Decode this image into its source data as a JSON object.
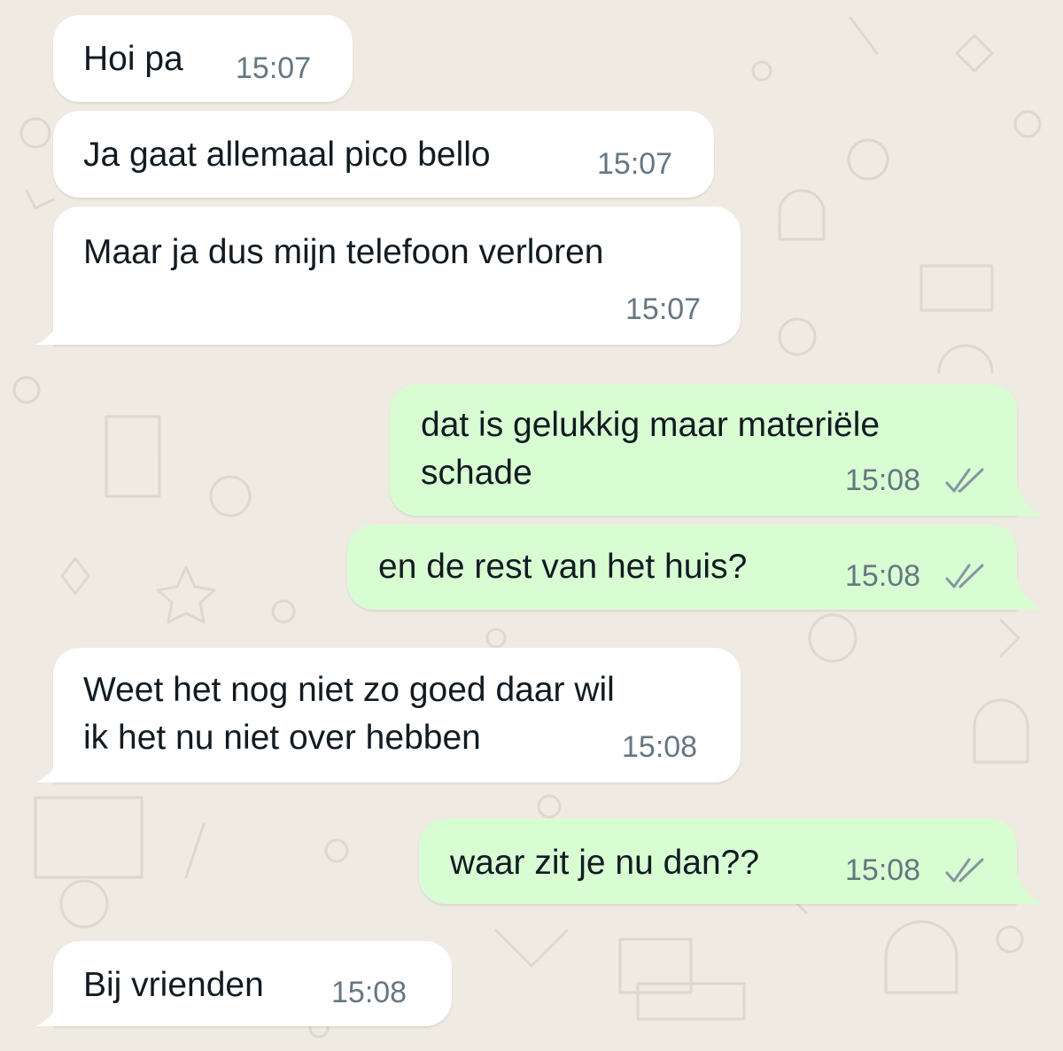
{
  "colors": {
    "wallpaper": "#efeae2",
    "incoming_bubble": "#ffffff",
    "outgoing_bubble": "#d9fdd3",
    "timestamp": "#667781",
    "text": "#111b21"
  },
  "messages": [
    {
      "direction": "incoming",
      "text": "Hoi pa",
      "time": "15:07"
    },
    {
      "direction": "incoming",
      "text": "Ja gaat allemaal pico bello",
      "time": "15:07"
    },
    {
      "direction": "incoming",
      "text": "Maar ja dus mijn telefoon verloren",
      "time": "15:07"
    },
    {
      "direction": "outgoing",
      "line1": "dat is gelukkig maar materiële",
      "line2": "schade",
      "time": "15:08",
      "status_icon": "double-check-icon"
    },
    {
      "direction": "outgoing",
      "text": "en de rest van het huis?",
      "time": "15:08",
      "status_icon": "double-check-icon"
    },
    {
      "direction": "incoming",
      "line1": "Weet het nog niet zo goed daar wil",
      "line2": "ik het nu niet over hebben",
      "time": "15:08"
    },
    {
      "direction": "outgoing",
      "text": "waar zit je nu dan??",
      "time": "15:08",
      "status_icon": "double-check-icon"
    },
    {
      "direction": "incoming",
      "text": "Bij vrienden",
      "time": "15:08"
    }
  ]
}
